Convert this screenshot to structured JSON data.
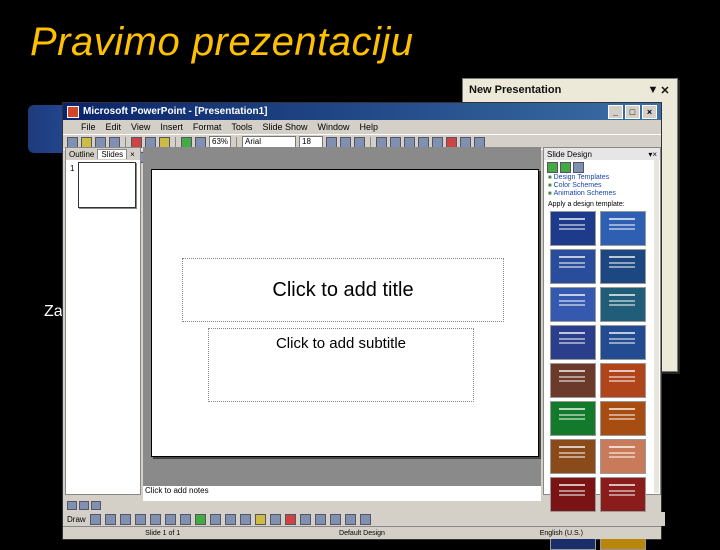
{
  "slide": {
    "title": "Pravimo prezentaciju",
    "side_text": "Za"
  },
  "back_window": {
    "title": "New Presentation",
    "dropdown_glyph": "▼",
    "close_glyph": "✕"
  },
  "app": {
    "window_title": "Microsoft PowerPoint - [Presentation1]",
    "menu": [
      "File",
      "Edit",
      "View",
      "Insert",
      "Format",
      "Tools",
      "Slide Show",
      "Window",
      "Help"
    ],
    "zoom": "63%",
    "font_name": "Arial",
    "font_size": "18",
    "tabs": {
      "outline": "Outline",
      "slides": "Slides"
    },
    "thumbnail_number": "1",
    "placeholders": {
      "title": "Click to add title",
      "subtitle": "Click to add subtitle",
      "notes": "Click to add notes"
    },
    "task_pane": {
      "title": "Slide Design",
      "links": [
        "Design Templates",
        "Color Schemes",
        "Animation Schemes"
      ],
      "section_label": "Apply a design template:"
    },
    "draw_label": "Draw",
    "status": [
      "Slide 1 of 1",
      "Default Design",
      "English (U.S.)"
    ],
    "template_colors": [
      "#1e3a8a",
      "#2f5fb3",
      "#2a4d9b",
      "#1c4780",
      "#3659b0",
      "#1f5d78",
      "#2b3e8c",
      "#234b92",
      "#6b3a2a",
      "#b0451c",
      "#127a2a",
      "#a84d12",
      "#8a4a1a",
      "#c87a5a",
      "#7a1414",
      "#8a1c1c",
      "#1a2f6a",
      "#b8860b"
    ]
  }
}
